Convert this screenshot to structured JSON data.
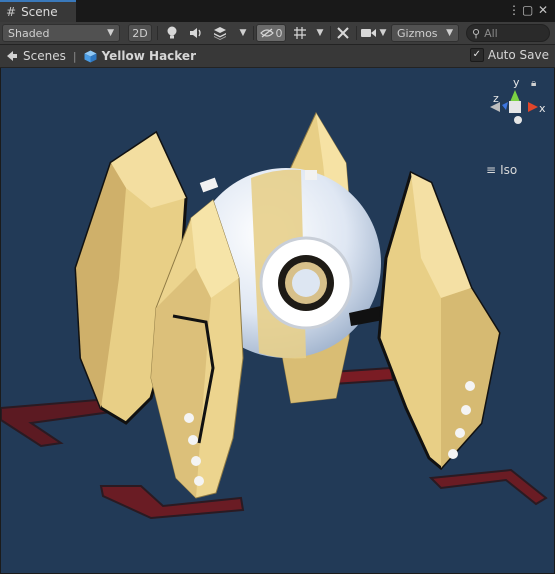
{
  "window": {
    "tab_title": "Scene",
    "tab_icon": "grid-icon",
    "controls": [
      "⋮",
      "▢",
      "✕"
    ]
  },
  "toolbar": {
    "draw_mode": "Shaded",
    "mode_2d": "2D",
    "hidden_count": "0",
    "gizmos_label": "Gizmos",
    "search_placeholder": "All"
  },
  "breadcrumb": {
    "root": "Scenes",
    "current": "Yellow Hacker"
  },
  "autosave": {
    "label": "Auto Save",
    "checked": true
  },
  "viewport": {
    "projection_label": "Iso",
    "axis_labels": {
      "x": "x",
      "y": "y",
      "z": "z"
    },
    "colors": {
      "background": "#223a57",
      "x_axis": "#e0462a",
      "y_axis": "#7bd243",
      "z_axis": "#3c75e0",
      "gold": "#ebd38c",
      "white_shell": "#e8eef7",
      "red_marker": "#7a1c24"
    }
  }
}
